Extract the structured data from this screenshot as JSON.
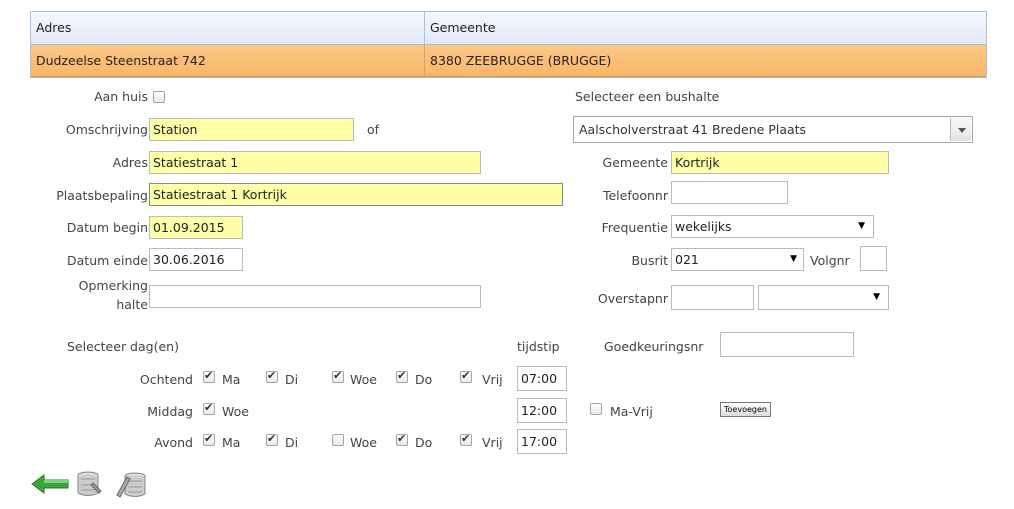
{
  "grid": {
    "headers": [
      "Adres",
      "Gemeente"
    ],
    "row": {
      "adres": "Dudzeelse Steenstraat 742",
      "gemeente": "8380 ZEEBRUGGE (BRUGGE)"
    }
  },
  "left": {
    "aan_huis_label": "Aan huis",
    "aan_huis_checked": false,
    "omschrijving_label": "Omschrijving",
    "omschrijving_value": "Station",
    "of_label": "of",
    "adres_label": "Adres",
    "adres_value": "Statiestraat 1",
    "plaatsbepaling_label": "Plaatsbepaling",
    "plaatsbepaling_value": "Statiestraat 1 Kortrijk",
    "datum_begin_label": "Datum begin",
    "datum_begin_value": "01.09.2015",
    "datum_einde_label": "Datum einde",
    "datum_einde_value": "30.06.2016",
    "opmerking_label_1": "Opmerking",
    "opmerking_label_2": "halte",
    "opmerking_value": ""
  },
  "right": {
    "bushalte_label": "Selecteer een bushalte",
    "bushalte_value": "Aalscholverstraat 41 Bredene Plaats",
    "gemeente_label": "Gemeente",
    "gemeente_value": "Kortrijk",
    "telefoon_label": "Telefoonnr",
    "telefoon_value": "",
    "frequentie_label": "Frequentie",
    "frequentie_value": "wekelijks",
    "busrit_label": "Busrit",
    "busrit_value": "021",
    "volgnr_label": "Volgnr",
    "volgnr_value": "",
    "overstap_label": "Overstapnr",
    "overstap_value": "",
    "overstap_select": "",
    "goedkeuring_label": "Goedkeuringsnr",
    "goedkeuring_value": ""
  },
  "schedule": {
    "title": "Selecteer dag(en)",
    "tijdstip_label": "tijdstip",
    "ma_vrij_label": "Ma-Vrij",
    "ma_vrij_checked": false,
    "toevoegen_label": "Toevoegen",
    "rows": [
      {
        "label": "Ochtend",
        "time": "07:00",
        "days": [
          {
            "name": "Ma",
            "checked": true
          },
          {
            "name": "Di",
            "checked": true
          },
          {
            "name": "Woe",
            "checked": true
          },
          {
            "name": "Do",
            "checked": true
          },
          {
            "name": "Vrij",
            "checked": true
          }
        ]
      },
      {
        "label": "Middag",
        "time": "12:00",
        "days": [
          {
            "name": "Woe",
            "checked": true
          }
        ]
      },
      {
        "label": "Avond",
        "time": "17:00",
        "days": [
          {
            "name": "Ma",
            "checked": true
          },
          {
            "name": "Di",
            "checked": true
          },
          {
            "name": "Woe",
            "checked": false
          },
          {
            "name": "Do",
            "checked": true
          },
          {
            "name": "Vrij",
            "checked": true
          }
        ]
      }
    ]
  },
  "footer_icons": [
    "back-arrow-icon",
    "database-icon",
    "database-edit-icon"
  ],
  "colors": {
    "selected_row": "#f9b766",
    "highlight_field": "#ffffa8",
    "header": "#dfe9f5",
    "arrow_green": "#3aa63a"
  }
}
